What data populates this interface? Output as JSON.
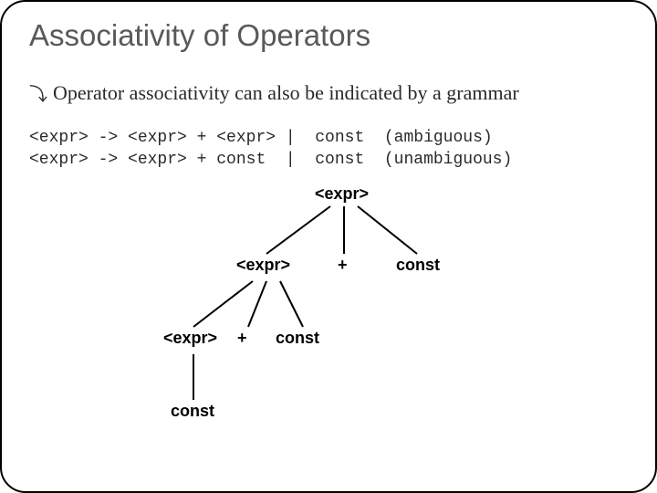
{
  "title": "Associativity of Operators",
  "bullet_icon": "⤵",
  "bullet_text": "Operator associativity can also be indicated by a grammar",
  "grammar": "<expr> -> <expr> + <expr> |  const  (ambiguous)\n<expr> -> <expr> + const  |  const  (unambiguous)",
  "tree": {
    "n_root": "<expr>",
    "n_l1_expr": "<expr>",
    "n_l1_plus": "+",
    "n_l1_const": "const",
    "n_l2_expr": "<expr>",
    "n_l2_plus": "+",
    "n_l2_const": "const",
    "n_l3_const": "const"
  }
}
